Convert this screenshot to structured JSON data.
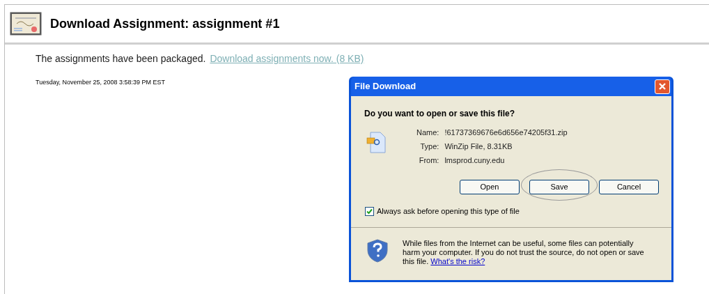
{
  "page": {
    "title": "Download Assignment: assignment #1",
    "message": "The assignments have been packaged.",
    "download_link": "Download assignments now. (8 KB)",
    "timestamp": "Tuesday, November 25, 2008 3:58:39 PM EST"
  },
  "dialog": {
    "title": "File Download",
    "question": "Do you want to open or save this file?",
    "fields": [
      {
        "label": "Name:",
        "value": "!61737369676e6d656e74205f31.zip"
      },
      {
        "label": "Type:",
        "value": "WinZip File, 8.31KB"
      },
      {
        "label": "From:",
        "value": "lmsprod.cuny.edu"
      }
    ],
    "buttons": [
      {
        "label": "Open",
        "circled": false
      },
      {
        "label": "Save",
        "circled": true
      },
      {
        "label": "Cancel",
        "circled": false
      }
    ],
    "checkbox": {
      "label": "Always ask before opening this type of file",
      "checked": true
    },
    "warning": "While files from the Internet can be useful, some files can potentially harm your computer. If you do not trust the source, do not open or save this file.",
    "risk_link": "What's the risk?"
  }
}
